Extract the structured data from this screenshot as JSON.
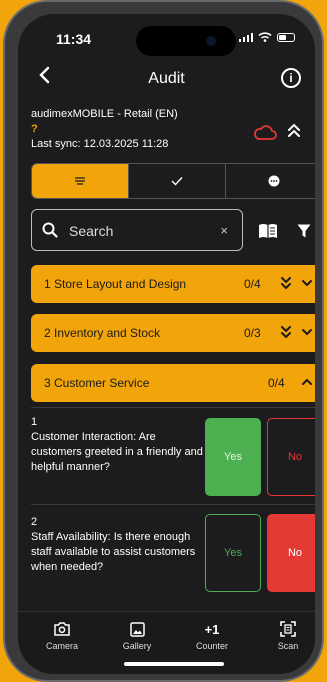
{
  "status_bar": {
    "time": "11:34"
  },
  "header": {
    "title": "Audit",
    "back_icon": "chevron-left-icon",
    "info_icon": "info-icon"
  },
  "audit_meta": {
    "name": "audimexMOBILE - Retail (EN)",
    "flag": "?",
    "last_sync": "Last sync: 12.03.2025 11:28",
    "cloud_icon": "cloud-icon",
    "cloud_color": "#e53935"
  },
  "segments": [
    {
      "icon": "list-icon",
      "active": true
    },
    {
      "icon": "checkmark-icon",
      "active": false
    },
    {
      "icon": "more-icon",
      "active": false
    }
  ],
  "search": {
    "placeholder": "Search",
    "clear": "×"
  },
  "sections": [
    {
      "label": "1  Store Layout and Design",
      "count": "0/4",
      "expanded": false
    },
    {
      "label": "2  Inventory and Stock",
      "count": "0/3",
      "expanded": false
    },
    {
      "label": "3  Customer Service",
      "count": "0/4",
      "expanded": true
    }
  ],
  "questions": [
    {
      "number": "1",
      "text": "Customer Interaction: Are customers greeted in a friendly and helpful manner?",
      "yes": "Yes",
      "no": "No",
      "answer": "yes"
    },
    {
      "number": "2",
      "text": "Staff Availability: Is there enough staff available to assist customers when needed?",
      "yes": "Yes",
      "no": "No",
      "answer": "no"
    }
  ],
  "bottom_tabs": [
    {
      "label": "Camera",
      "icon": "camera-icon"
    },
    {
      "label": "Gallery",
      "icon": "gallery-icon"
    },
    {
      "label": "Counter",
      "icon": "+1"
    },
    {
      "label": "Scan",
      "icon": "scan-icon"
    }
  ],
  "colors": {
    "accent": "#f2a50a",
    "yes": "#4caf50",
    "no": "#e53935",
    "background": "#1c1c1e"
  }
}
